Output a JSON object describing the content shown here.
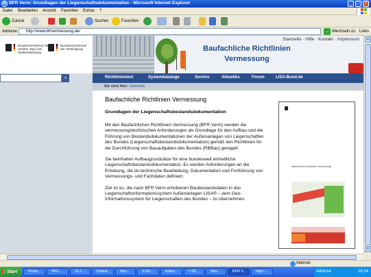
{
  "window": {
    "title": "BFR Verm: Grundlagen der Liegenschaftsdokumentation - Microsoft Internet Explorer",
    "buttons": {
      "minimize": "_",
      "maximize": "□",
      "close": "×"
    }
  },
  "menu": [
    "Datei",
    "Bearbeiten",
    "Ansicht",
    "Favoriten",
    "Extras",
    "?"
  ],
  "toolbar": {
    "back": "Zurück",
    "search": "Suchen",
    "favorites": "Favoriten"
  },
  "address": {
    "label": "Adresse",
    "url": "http://www.bfrvermessung.de/",
    "go_label": "Wechseln zu",
    "links_label": "Links"
  },
  "site": {
    "ministry1": "Bundesministerium für Verkehr, Bau und Stadtentwicklung",
    "ministry2": "Bundesministerium der Verteidigung",
    "toplinks": "Startseite · Hilfe · Kontakt · Impressum",
    "title_line1": "Baufachliche Richtlinien",
    "title_line2": "Vermessung",
    "search_go": "»",
    "nav": [
      "Richtlinientext",
      "Systemkataloge",
      "Service",
      "Aktuelles",
      "Forum",
      "LISA-Bund.de"
    ],
    "breadcrumb_prefix": "Sie sind hier:",
    "breadcrumb_page": "Startseite"
  },
  "content": {
    "heading": "Baufachliche Richtlinien Vermessung",
    "subheading": "Grundlagen der Liegenschaftsbestandsdokumentation",
    "p1": "Mit den Baufachlichen Richtlinien Vermessung (BFR Verm) werden die vermessungstechnischen Anforderungen als Grundlage für den Aufbau und die Führung von Bestandsdokumentationen der Außenanlagen von Liegenschaften des Bundes (Liegenschaftsbestandsdokumentation) gemäß den Richtlinien für die Durchführung von Bauaufgaben des Bundes (RBBau) geregelt.",
    "p2": "Sie beinhalten Aufbaugrundsätze für eine bundesweit einheitliche Liegenschaftsbestandsdokumentation. Es werden Anforderungen an die Erhebung, die dv-technische Bearbeitung, Dokumentation und Fortführung von Vermessungs- und Fachdaten definiert.",
    "p3": "Ziel ist es, die nach BFR Verm erhobenen Baubestandsdaten in das Liegenschaftsinformationssystem Außenanlagen LISA® – dem Geo-Informationssystem für Liegenschaften des Bundes – zu übernehmen.",
    "thumb_title": "Baufachliche Richtlinien Vermessung"
  },
  "status": {
    "zone": "Internet"
  },
  "taskbar": {
    "start": "Start",
    "tasks": [
      "Poste...",
      "WG:...",
      "DLZ ...",
      "Einled...",
      "Abs...",
      "S:\\Hi...",
      "Index...",
      "I:\\20...",
      "Abs...",
      "BFR V...",
      "http:/..."
    ],
    "active_index": 9,
    "tray_label": "Adresse",
    "clock": "16:14"
  }
}
